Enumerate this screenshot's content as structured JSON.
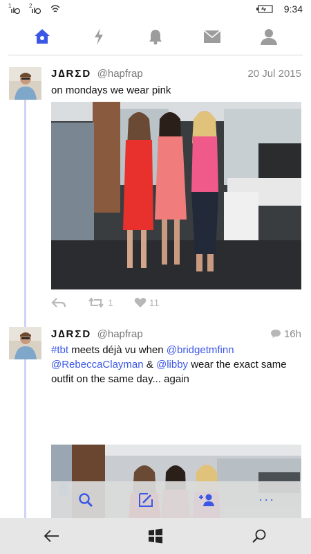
{
  "status_bar": {
    "sim1": "1",
    "sim2": "2",
    "time": "9:34"
  },
  "nav": {
    "tabs": [
      {
        "name": "home",
        "icon": "home-icon",
        "active": true
      },
      {
        "name": "notifications",
        "icon": "lightning-icon"
      },
      {
        "name": "mentions",
        "icon": "bell-icon"
      },
      {
        "name": "messages",
        "icon": "envelope-icon"
      },
      {
        "name": "profile",
        "icon": "person-icon"
      }
    ]
  },
  "colors": {
    "accent": "#3b57e6",
    "thread_line": "#cfd2f6",
    "muted": "#b7b7b7"
  },
  "tweets": [
    {
      "author": "J∆RΣD",
      "handle": "@hapfrap",
      "date": "20 Jul 2015",
      "text": "on mondays we wear pink",
      "retweets": "1",
      "likes": "11"
    },
    {
      "author": "J∆RΣD",
      "handle": "@hapfrap",
      "date": "16h",
      "text_parts": {
        "tag": "#tbt",
        "t1": " meets déjà vu when ",
        "m1": "@bridgetmfinn",
        "m2": "@RebeccaClayman",
        "t2": " & ",
        "m3": "@libby",
        "t3": " wear the exact same outfit on the same day... again"
      }
    }
  ],
  "app_bar": {
    "more": "···"
  }
}
